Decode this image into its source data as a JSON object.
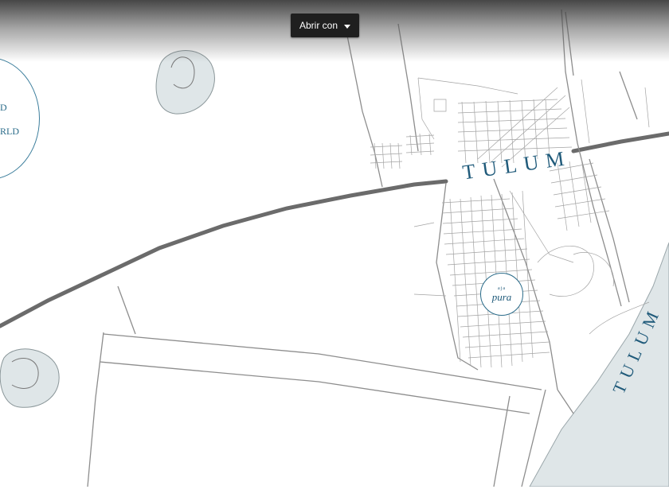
{
  "viewer": {
    "open_with_label": "Abrir con"
  },
  "map": {
    "town_label": "TULUM",
    "beach_label": "TULUM",
    "pura_small": "aja",
    "pura_label": "pura",
    "badge_line_1": "D",
    "badge_line_2": "RLD"
  },
  "colors": {
    "sea": "#dfe6e8",
    "lagoon": "#dfe6e8",
    "road": "#6b6b6b",
    "street": "#8d8d8d",
    "label": "#1f5a7a"
  },
  "icons": {
    "dropdown": "caret-down-icon"
  }
}
